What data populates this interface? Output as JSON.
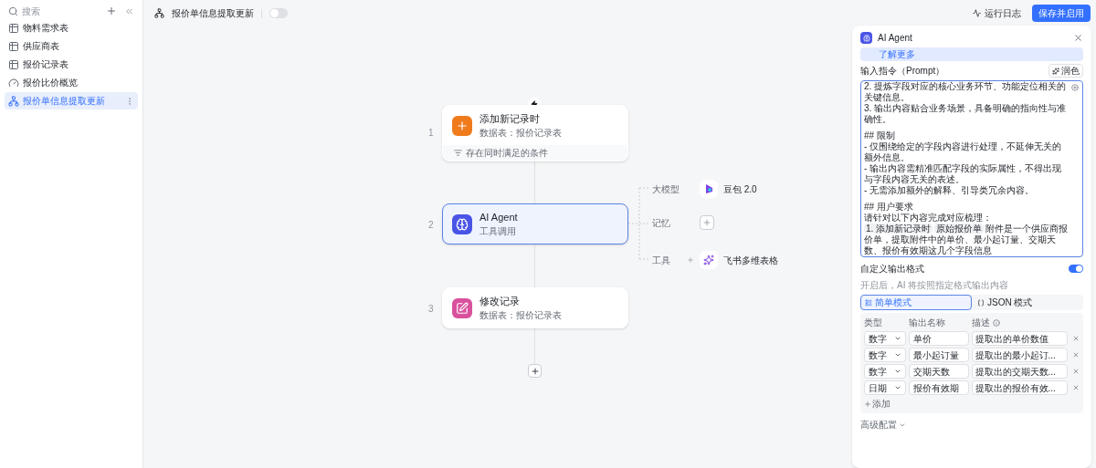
{
  "sidebar": {
    "search": {
      "placeholder": "搜索"
    },
    "items": [
      {
        "label": "物料需求表",
        "kind": "table",
        "selected": false
      },
      {
        "label": "供应商表",
        "kind": "table",
        "selected": false
      },
      {
        "label": "报价记录表",
        "kind": "table",
        "selected": false
      },
      {
        "label": "报价比价概览",
        "kind": "dashboard",
        "selected": false
      },
      {
        "label": "报价单信息提取更新",
        "kind": "workflow",
        "selected": true
      }
    ]
  },
  "topbar": {
    "title": "报价单信息提取更新",
    "enabled": false,
    "log_button": "运行日志",
    "save_button": "保存并启用"
  },
  "flow": {
    "nodes": [
      {
        "index": "1",
        "title": "添加新记录时",
        "subtitle": "数据表：报价记录表",
        "kind": "trigger",
        "footer": "存在同时满足的条件",
        "selected": false
      },
      {
        "index": "2",
        "title": "AI Agent",
        "subtitle": "工具调用",
        "kind": "agent",
        "selected": true
      },
      {
        "index": "3",
        "title": "修改记录",
        "subtitle": "数据表：报价记录表",
        "kind": "edit",
        "selected": false
      }
    ],
    "branches": [
      {
        "label": "大模型",
        "target": "豆包 2.0",
        "kind": "model"
      },
      {
        "label": "记忆",
        "kind": "empty"
      },
      {
        "label": "工具",
        "target": "飞书多维表格",
        "kind": "tool"
      }
    ]
  },
  "panel": {
    "title": "AI Agent",
    "learn_more": "了解更多",
    "prompt_label": "输入指令（Prompt）",
    "polish_button": "润色",
    "prompt_blocks": [
      [
        "2. 提炼字段对应的核心业务环节、功能定位相关的关键信息。",
        "3. 输出内容贴合业务场景，具备明确的指向性与准确性。"
      ],
      [
        "## 限制",
        "- 仅围绕给定的字段内容进行处理，不延伸无关的额外信息。",
        "- 输出内容需精准匹配字段的实际属性，不得出现与字段内容无关的表述。",
        "- 无需添加额外的解释、引导类冗余内容。"
      ],
      [
        "## 用户要求",
        "请针对以下内容完成对应梳理："
      ]
    ],
    "prompt_chips": [
      "1. 添加新记录时",
      "原始报价单"
    ],
    "prompt_tail": "附件是一个供应商报价单，提取附件中的单价、最小起订量、交期天数、报价有效期这几个字段信息",
    "custom_output": {
      "label": "自定义输出格式",
      "on": true,
      "hint": "开启后，AI 将按照指定格式输出内容",
      "modes": [
        {
          "label": "简单模式",
          "kind": "simple",
          "selected": true
        },
        {
          "label": "JSON 模式",
          "kind": "json",
          "selected": false
        }
      ],
      "columns": [
        "类型",
        "输出名称",
        "描述"
      ],
      "rows": [
        {
          "type": "数字",
          "name": "单价",
          "desc": "提取出的单价数值"
        },
        {
          "type": "数字",
          "name": "最小起订量",
          "desc": "提取出的最小起订..."
        },
        {
          "type": "数字",
          "name": "交期天数",
          "desc": "提取出的交期天数..."
        },
        {
          "type": "日期",
          "name": "报价有效期",
          "desc": "提取出的报价有效..."
        }
      ],
      "add": "添加"
    },
    "advanced": "高级配置"
  }
}
